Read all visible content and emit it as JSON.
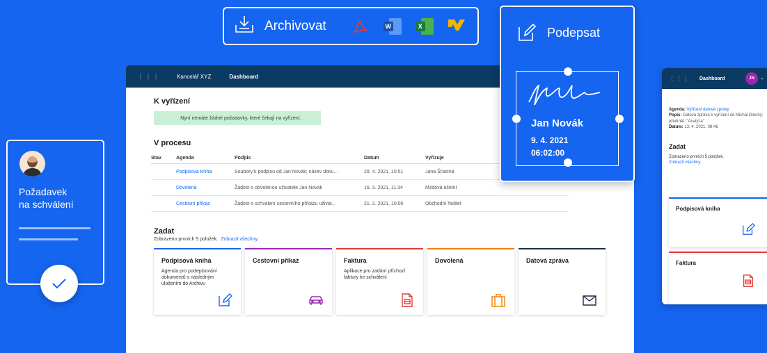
{
  "archive": {
    "label": "Archivovat",
    "icons": [
      "download-tray-icon",
      "pdf-icon",
      "word-icon",
      "excel-icon",
      "m-logo-icon"
    ],
    "word_letter": "W",
    "excel_letter": "X"
  },
  "main": {
    "topbar": {
      "org": "Kancelář XYZ",
      "dashboard": "Dashboard"
    },
    "k_vyrizeni": {
      "title": "K vyřízení",
      "notice": "Nyní nemáte žádné požadavky, které čekají na vyřízení."
    },
    "v_procesu": {
      "title": "V procesu",
      "columns": {
        "stav": "Stav",
        "agenda": "Agenda",
        "podpis": "Podpis",
        "datum": "Datum",
        "vyrizuje": "Vyřizuje"
      },
      "rows": [
        {
          "agenda": "Podpisová kniha",
          "podpis": "Soubory k podpisu od Jan Novák; název doku...",
          "datum": "28. 4. 2021, 10:51",
          "vyrizuje": "Jana Šťastná"
        },
        {
          "agenda": "Dovolená",
          "podpis": "Žádost o dovolenou uživatele Jan Novák",
          "datum": "16. 3. 2021, 11:34",
          "vyrizuje": "Mzdová účetní"
        },
        {
          "agenda": "Cestovní příkaz",
          "podpis": "Žádost o schválení cestovního příkazu uživat...",
          "datum": "21. 2. 2021, 10:00",
          "vyrizuje": "Obchodní ředitel"
        }
      ]
    },
    "zadat": {
      "title": "Zadat",
      "subtitle": "Zobrazeno prvních 5 položek.",
      "show_all": "Zobrazit všechny.",
      "cards": [
        {
          "title": "Podpisová kniha",
          "desc": "Agenda pro podepisování dokumentů s následným uložením do Archivu",
          "color": "#1565f0",
          "icon": "edit-icon"
        },
        {
          "title": "Cestovní příkaz",
          "desc": "",
          "color": "#9c27b0",
          "icon": "car-icon"
        },
        {
          "title": "Faktura",
          "desc": "Aplikace pro zadání příchozí faktury ke schválení",
          "color": "#e53935",
          "icon": "invoice-icon"
        },
        {
          "title": "Dovolená",
          "desc": "",
          "color": "#f57c00",
          "icon": "suitcase-icon"
        },
        {
          "title": "Datová zpráva",
          "desc": "",
          "color": "#1e2a44",
          "icon": "envelope-icon"
        }
      ]
    }
  },
  "sign": {
    "title": "Podepsat",
    "name": "Jan Novák",
    "date": "9. 4. 2021",
    "time": "06:02:00"
  },
  "request": {
    "line1": "Požadavek",
    "line2": "na schválení"
  },
  "mobile": {
    "dashboard": "Dashboard",
    "avatar": "JN",
    "agenda_label": "Agenda:",
    "agenda_value": "Vyřízení datové zprávy",
    "popis_label": "Popis:",
    "popis_value": "Datová zpráva k vyřízení od Michal Dlouhý; předmět: \"Analýza\"",
    "datum_label": "Datum:",
    "datum_value": "13. 4. 2021, 08:48",
    "zadat": "Zadat",
    "subtitle": "Zobrazeno prvních 5 položek.",
    "show_all": "Zobrazit všechny.",
    "card1": "Podpisová kniha",
    "card2": "Faktura"
  }
}
